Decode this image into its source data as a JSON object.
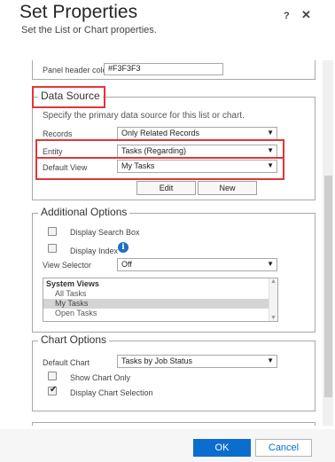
{
  "dialog": {
    "title": "Set Properties",
    "subtitle": "Set the List or Chart properties.",
    "help": "?",
    "close": "✕"
  },
  "appearance": {
    "panel_header_color_label": "Panel header color",
    "panel_header_color_value": "#F3F3F3"
  },
  "data_source": {
    "legend": "Data Source",
    "description": "Specify the primary data source for this list or chart.",
    "records_label": "Records",
    "records_value": "Only Related Records",
    "entity_label": "Entity",
    "entity_value": "Tasks (Regarding)",
    "default_view_label": "Default View",
    "default_view_value": "My Tasks",
    "edit_label": "Edit",
    "new_label": "New"
  },
  "additional_options": {
    "legend": "Additional Options",
    "display_search_box_label": "Display Search Box",
    "display_search_box_checked": false,
    "display_index_label": "Display Index",
    "display_index_checked": false,
    "view_selector_label": "View Selector",
    "view_selector_value": "Off",
    "views_header": "System Views",
    "views": [
      "All Tasks",
      "My Tasks",
      "Open Tasks"
    ],
    "selected_view": "My Tasks"
  },
  "chart_options": {
    "legend": "Chart Options",
    "default_chart_label": "Default Chart",
    "default_chart_value": "Tasks by Job Status",
    "show_chart_only_label": "Show Chart Only",
    "show_chart_only_checked": false,
    "display_chart_selection_label": "Display Chart Selection",
    "display_chart_selection_checked": true
  },
  "footer": {
    "ok_label": "OK",
    "cancel_label": "Cancel"
  },
  "colors": {
    "accent": "#0b6ecf",
    "highlight_box": "#e0373b",
    "info_icon": "#1e6fc5"
  }
}
